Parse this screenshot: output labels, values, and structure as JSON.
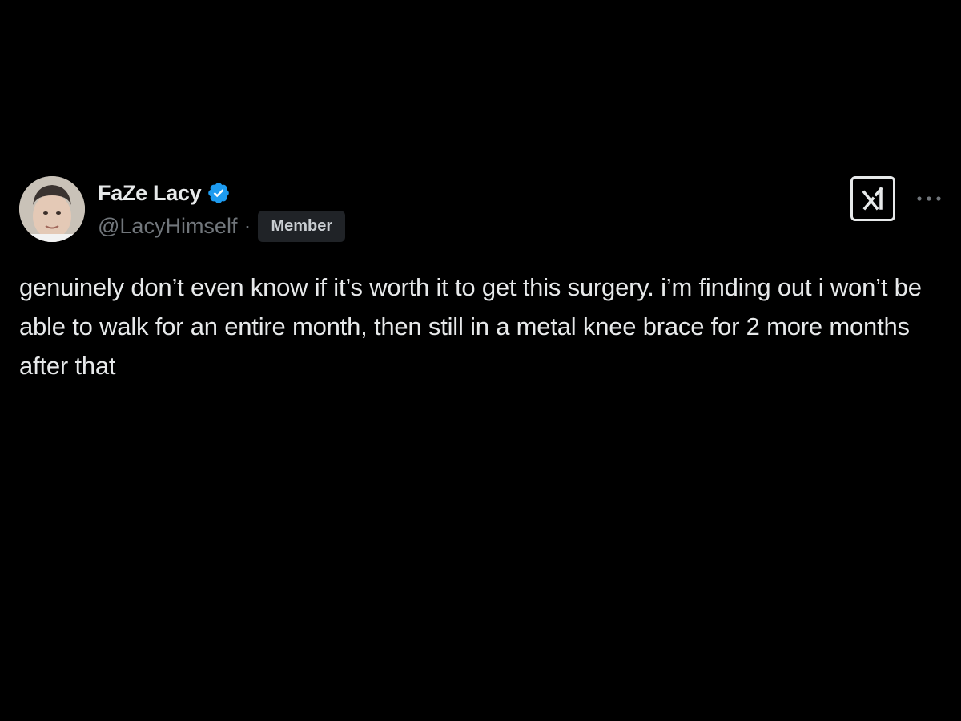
{
  "tweet": {
    "display_name": "FaZe Lacy",
    "handle": "@LacyHimself",
    "separator": "·",
    "badge": "Member",
    "text": "genuinely don’t even know if it’s worth it to get this surgery. i’m finding out i won’t be able to walk for an entire month, then still in a metal knee brace for 2 more months after that",
    "verified_icon": "verified-badge-icon",
    "more_icon": "more-options-icon",
    "grok_icon": "grok-icon"
  },
  "colors": {
    "background": "#000000",
    "primary_text": "#e7e9ea",
    "secondary_text": "#71767b",
    "verified_blue": "#1d9bf0",
    "badge_bg": "#202327"
  }
}
